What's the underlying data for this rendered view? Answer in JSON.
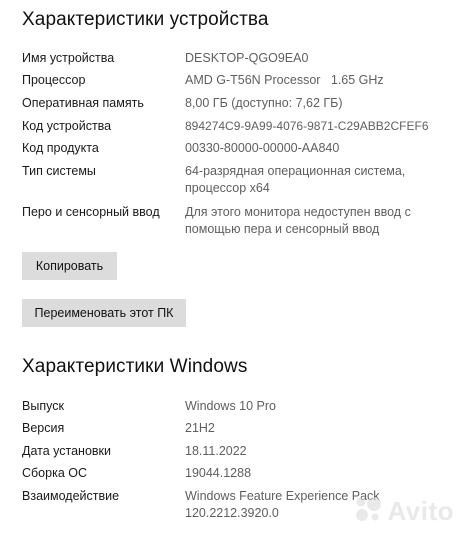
{
  "device_section": {
    "title": "Характеристики устройства",
    "rows": [
      {
        "label": "Имя устройства",
        "value": "DESKTOP-QGO9EA0"
      },
      {
        "label": "Процессор",
        "value": "AMD G-T56N Processor   1.65 GHz"
      },
      {
        "label": "Оперативная память",
        "value": "8,00 ГБ (доступно: 7,62 ГБ)"
      },
      {
        "label": "Код устройства",
        "value": "894274C9-9A99-4076-9871-C29ABB2CFEF6"
      },
      {
        "label": "Код продукта",
        "value": "00330-80000-00000-AA840"
      },
      {
        "label": "Тип системы",
        "value": "64-разрядная операционная система, процессор x64"
      },
      {
        "label": "Перо и сенсорный ввод",
        "value": "Для этого монитора недоступен ввод с помощью пера и сенсорный ввод"
      }
    ],
    "copy_button": "Копировать",
    "rename_button": "Переименовать этот ПК"
  },
  "windows_section": {
    "title": "Характеристики Windows",
    "rows": [
      {
        "label": "Выпуск",
        "value": "Windows 10 Pro"
      },
      {
        "label": "Версия",
        "value": "21H2"
      },
      {
        "label": "Дата установки",
        "value": "18.11.2022"
      },
      {
        "label": "Сборка ОС",
        "value": "19044.1288"
      },
      {
        "label": "Взаимодействие",
        "value": "Windows Feature Experience Pack 120.2212.3920.0"
      }
    ]
  },
  "watermark": {
    "text": "Avito",
    "colors": [
      "#d8d8d8"
    ]
  }
}
